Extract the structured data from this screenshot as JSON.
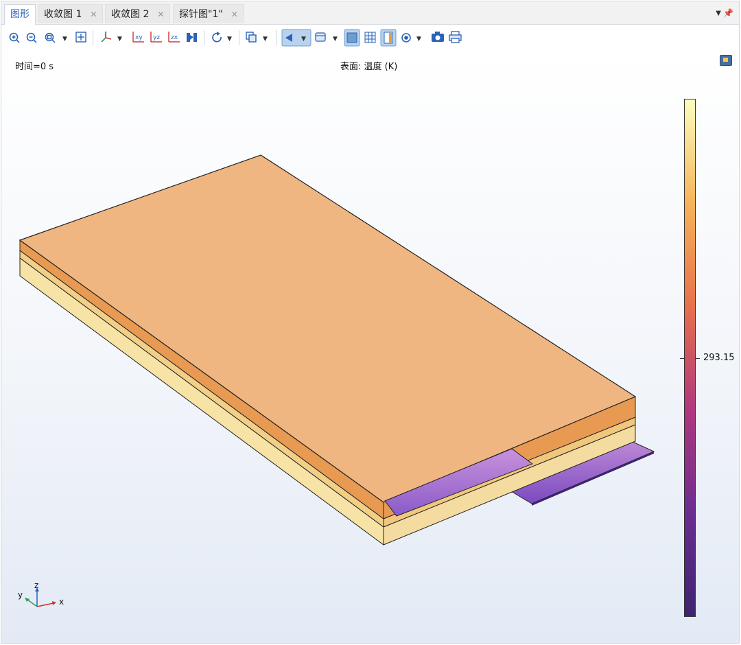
{
  "tabs": [
    {
      "label": "图形",
      "active": true,
      "closable": false
    },
    {
      "label": "收敛图 1",
      "active": false,
      "closable": true
    },
    {
      "label": "收敛图 2",
      "active": false,
      "closable": true
    },
    {
      "label": "探针图\"1\"",
      "active": false,
      "closable": true
    }
  ],
  "tab_controls": {
    "menu_icon": "dropdown-arrow-icon",
    "pin_icon": "pin-icon"
  },
  "toolbar": {
    "icons": [
      "zoom-in-icon",
      "zoom-out-icon",
      "zoom-box-icon",
      "zoom-extents-icon",
      "axis-orientation-icon",
      "view-xy-icon",
      "view-yz-icon",
      "view-zx-icon",
      "go-to-view-icon",
      "rotate-icon",
      "select-icon",
      "scene-light-icon",
      "render-icon",
      "grid-icon",
      "legend-icon",
      "show-axis-icon",
      "camera-icon",
      "print-icon"
    ]
  },
  "graphics": {
    "time_label": "时间=0 s",
    "surface_label": "表面: 温度 (K)",
    "scene_icon": "scene-light-icon"
  },
  "colorbar": {
    "tick_label": "293.15",
    "tick_fraction": 0.505,
    "colors": [
      "#fcfdbf",
      "#f5b45a",
      "#e7704c",
      "#b0387e",
      "#6b2d8f",
      "#3e2470"
    ]
  },
  "model_colors": {
    "top_face": "#f0b681",
    "top_layer_side": "#e89a52",
    "middle_layer_side": "#f2cf86",
    "bottom_layer_side": "#f7e3a6",
    "tab_light": "#b07ad8",
    "tab_dark": "#7a4ac0",
    "edge": "#222222"
  },
  "axes": {
    "x": "x",
    "y": "y",
    "z": "z"
  }
}
